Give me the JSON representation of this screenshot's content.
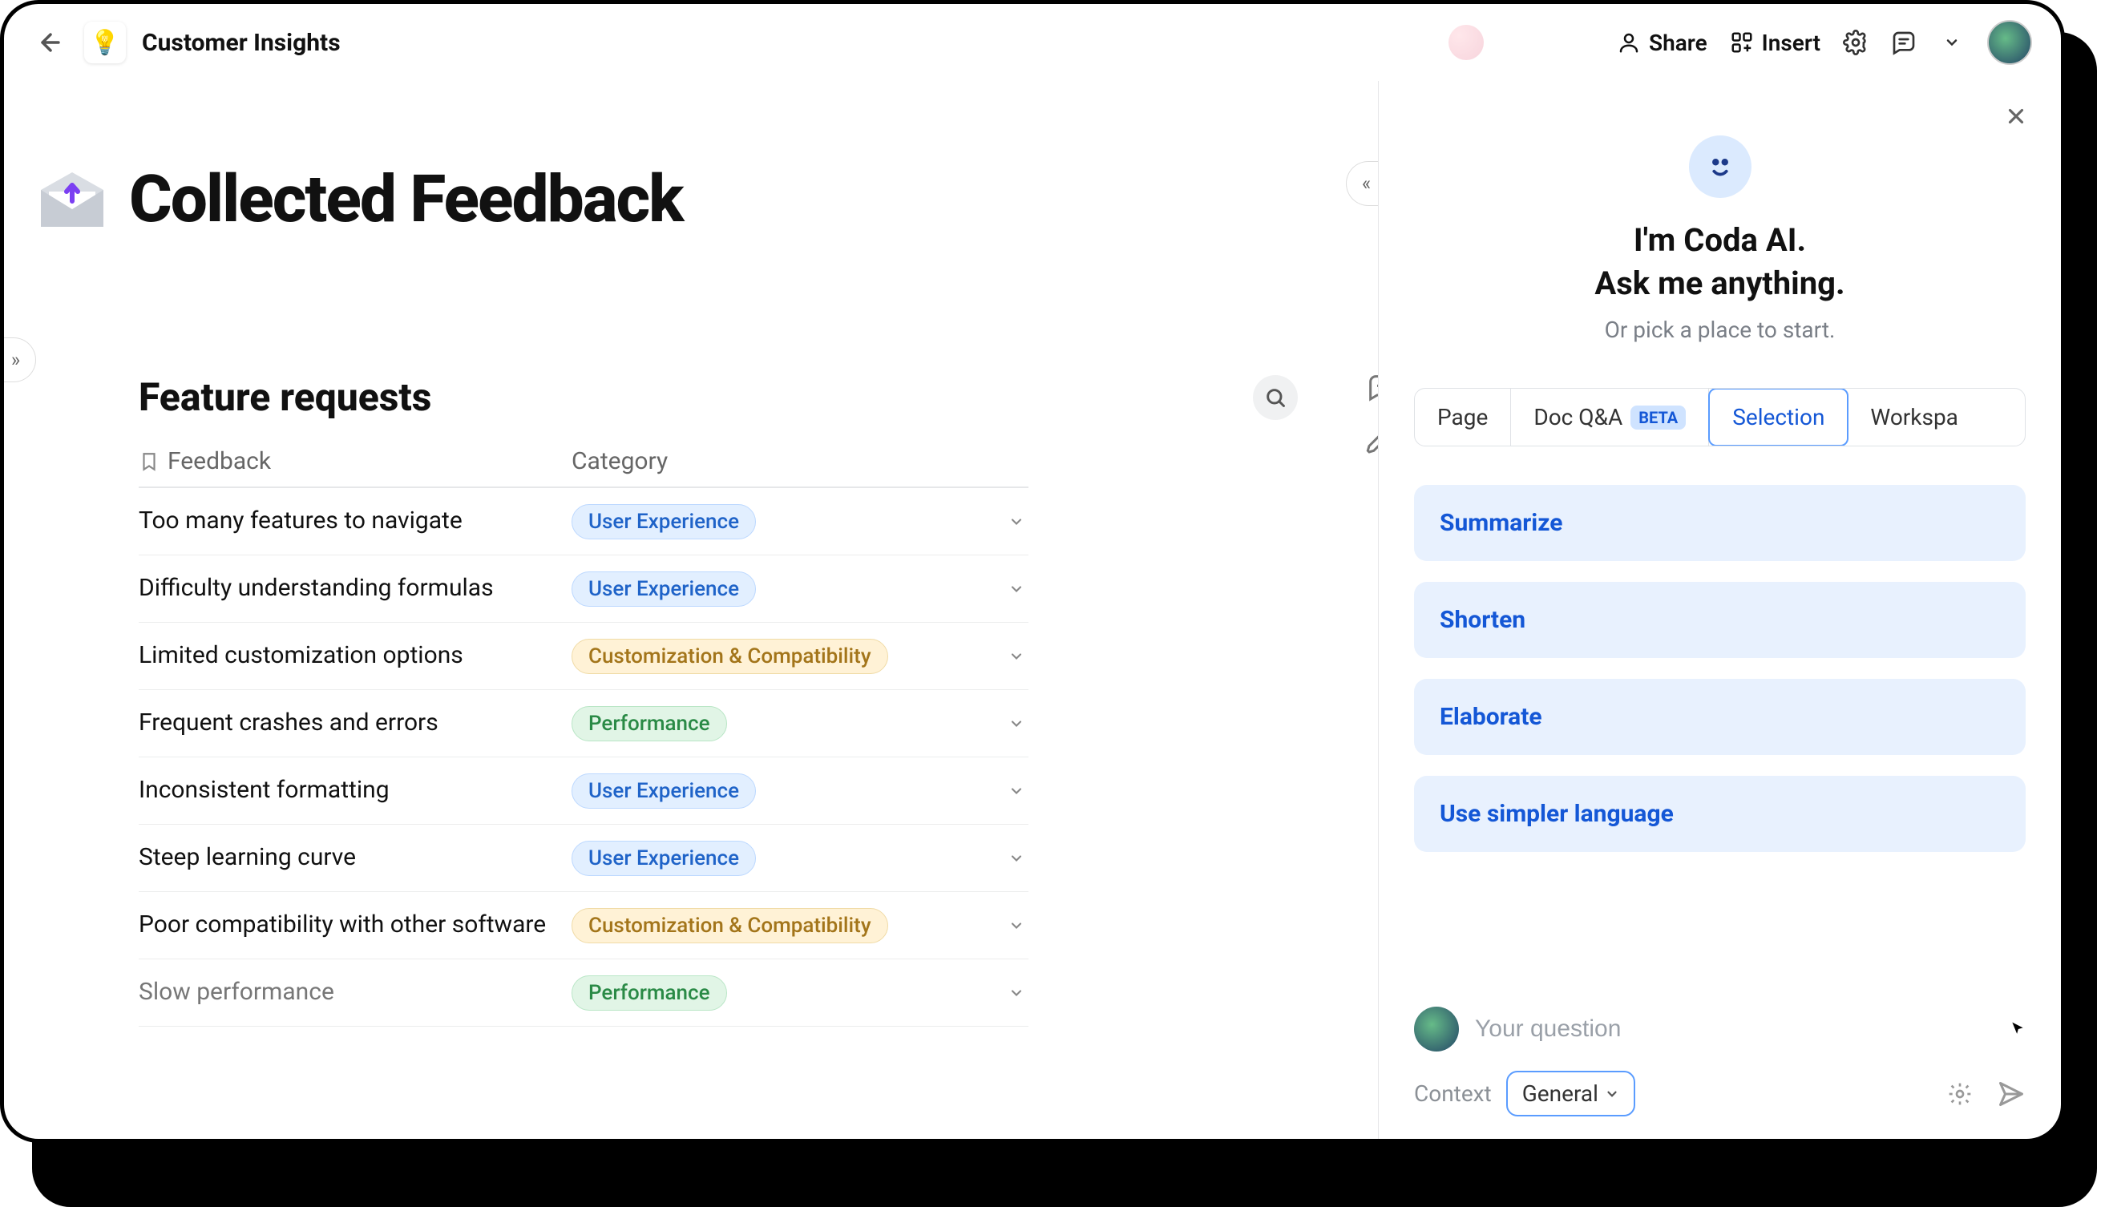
{
  "header": {
    "doc_title": "Customer Insights"
  },
  "toolbar": {
    "share_label": "Share",
    "insert_label": "Insert"
  },
  "page": {
    "title": "Collected Feedback"
  },
  "section": {
    "title": "Feature requests",
    "columns": {
      "feedback": "Feedback",
      "category": "Category"
    },
    "rows": [
      {
        "feedback": "Too many features to navigate",
        "category": "User Experience",
        "category_kind": "ux"
      },
      {
        "feedback": "Difficulty understanding formulas",
        "category": "User Experience",
        "category_kind": "ux"
      },
      {
        "feedback": "Limited customization options",
        "category": "Customization & Compatibility",
        "category_kind": "custom"
      },
      {
        "feedback": "Frequent crashes and errors",
        "category": "Performance",
        "category_kind": "perf"
      },
      {
        "feedback": "Inconsistent formatting",
        "category": "User Experience",
        "category_kind": "ux"
      },
      {
        "feedback": "Steep learning curve",
        "category": "User Experience",
        "category_kind": "ux"
      },
      {
        "feedback": "Poor compatibility with other software",
        "category": "Customization & Compatibility",
        "category_kind": "custom"
      },
      {
        "feedback": "Slow performance",
        "category": "Performance",
        "category_kind": "perf"
      }
    ]
  },
  "ai_panel": {
    "title_line1": "I'm Coda AI.",
    "title_line2": "Ask me anything.",
    "subtitle": "Or pick a place to start.",
    "tabs": {
      "page": "Page",
      "docqa": "Doc Q&A",
      "docqa_badge": "BETA",
      "selection": "Selection",
      "workspace": "Workspa"
    },
    "active_tab": "Selection",
    "suggestions": [
      "Summarize",
      "Shorten",
      "Elaborate",
      "Use simpler language"
    ],
    "composer": {
      "placeholder": "Your question",
      "context_label": "Context",
      "context_value": "General"
    }
  }
}
